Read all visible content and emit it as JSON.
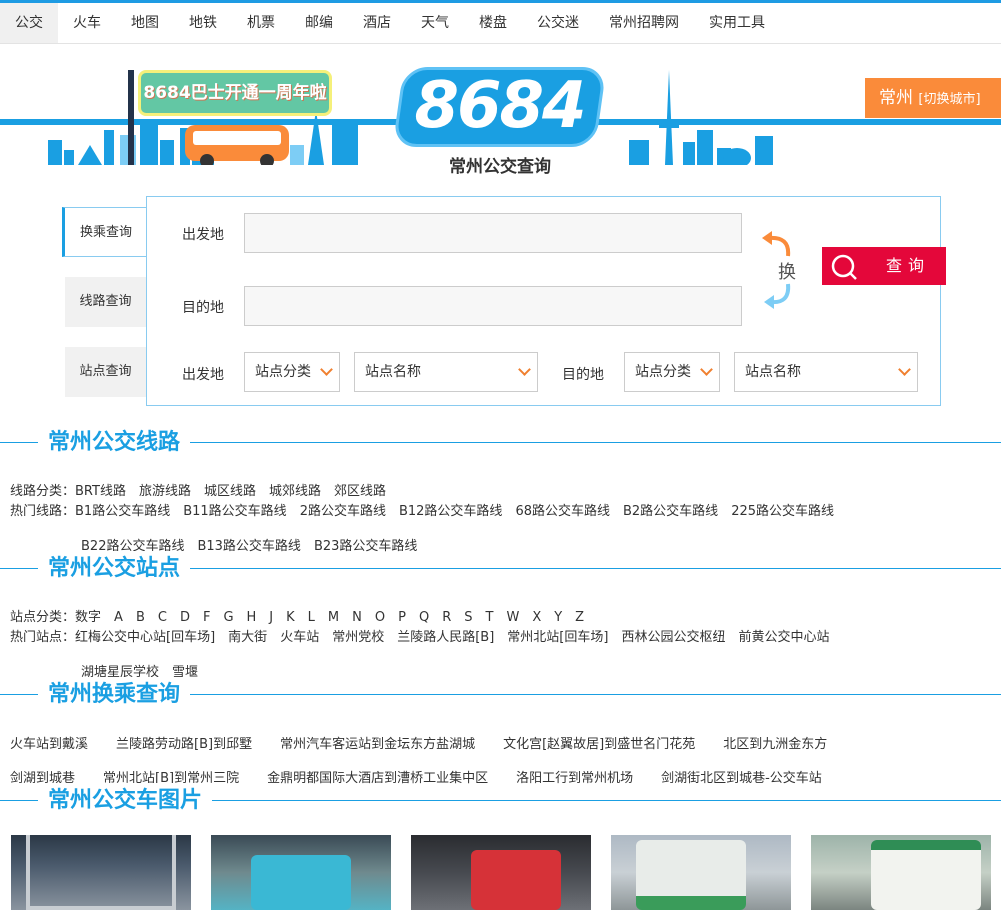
{
  "nav": {
    "items": [
      "公交",
      "火车",
      "地图",
      "地铁",
      "机票",
      "邮编",
      "酒店",
      "天气",
      "楼盘",
      "公交迷",
      "常州招聘网",
      "实用工具"
    ]
  },
  "banner": {
    "logo": "8684",
    "subtitle": "常州公交查询",
    "promo": "8684巴士开通一周年啦",
    "city": "常州",
    "city_switch": "[切换城市]"
  },
  "search": {
    "tabs": [
      "换乘查询",
      "线路查询",
      "站点查询"
    ],
    "from_label": "出发地",
    "to_label": "目的地",
    "swap_label": "换",
    "button_label": "查询",
    "station_category": "站点分类",
    "station_name": "站点名称",
    "from_label_2": "出发地",
    "to_label_2": "目的地"
  },
  "sections": {
    "lines": {
      "title": "常州公交线路",
      "category_label": "线路分类：",
      "categories": [
        "BRT线路",
        "旅游线路",
        "城区线路",
        "城郊线路",
        "郊区线路"
      ],
      "hot_label": "热门线路：",
      "hot": [
        "B1路公交车路线",
        "B11路公交车路线",
        "2路公交车路线",
        "B12路公交车路线",
        "68路公交车路线",
        "B2路公交车路线",
        "225路公交车路线"
      ],
      "hot2": [
        "B22路公交车路线",
        "B13路公交车路线",
        "B23路公交车路线"
      ]
    },
    "stations": {
      "title": "常州公交站点",
      "category_label": "站点分类：",
      "letters": [
        "数字",
        "A",
        "B",
        "C",
        "D",
        "F",
        "G",
        "H",
        "J",
        "K",
        "L",
        "M",
        "N",
        "O",
        "P",
        "Q",
        "R",
        "S",
        "T",
        "W",
        "X",
        "Y",
        "Z"
      ],
      "hot_label": "热门站点：",
      "hot": [
        "红梅公交中心站[回车场]",
        "南大街",
        "火车站",
        "常州党校",
        "兰陵路人民路[B]",
        "常州北站[回车场]",
        "西林公园公交枢纽",
        "前黄公交中心站"
      ],
      "hot2": [
        "湖塘星辰学校",
        "雪堰"
      ]
    },
    "transfer": {
      "title": "常州换乘查询",
      "row1": [
        "火车站到戴溪",
        "兰陵路劳动路[B]到邱墅",
        "常州汽车客运站到金坛东方盐湖城",
        "文化宫[赵翼故居]到盛世名门花苑",
        "北区到九洲金东方"
      ],
      "row2": [
        "剑湖到城巷",
        "常州北站[B]到常州三院",
        "金鼎明都国际大酒店到漕桥工业集中区",
        "洛阳工行到常州机场",
        "剑湖街北区到城巷-公交车站"
      ]
    },
    "photos": {
      "title": "常州公交车图片"
    }
  },
  "colors": {
    "brand_blue": "#1a9fe2",
    "orange": "#fa8b3a",
    "search_red": "#e4073a"
  }
}
